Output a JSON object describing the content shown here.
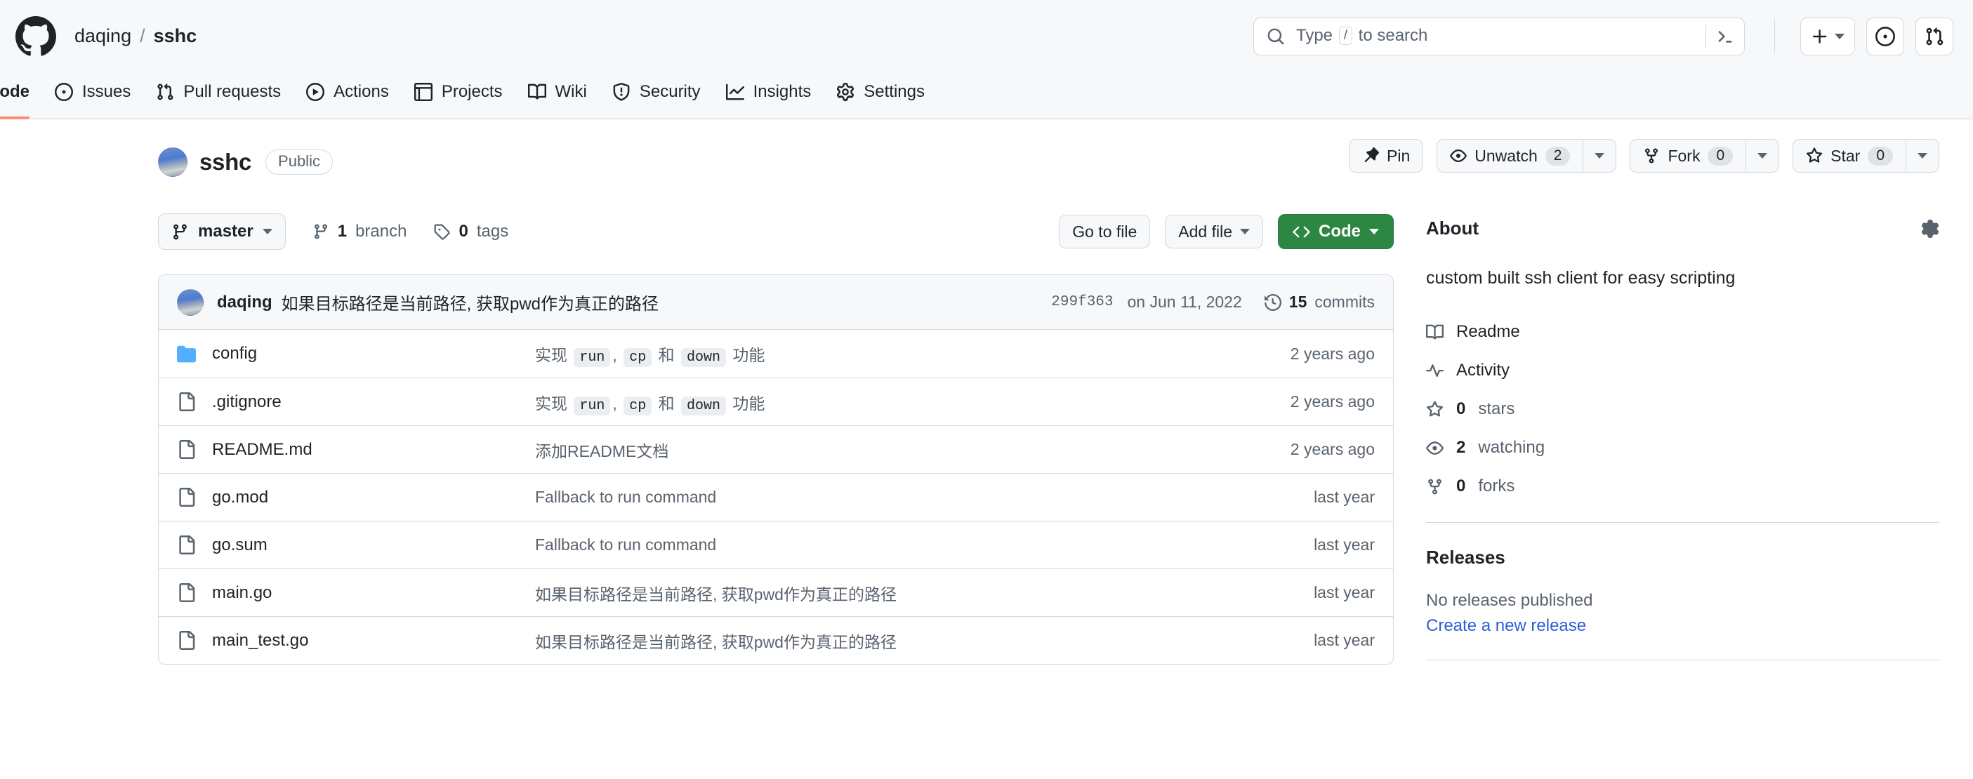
{
  "header": {
    "logo_icon": "github-logo-icon",
    "breadcrumb": {
      "owner": "daqing",
      "separator": "/",
      "repo": "sshc"
    },
    "search": {
      "placeholder_prefix": "Type",
      "key_hint": "/",
      "placeholder_suffix": "to search",
      "search_icon": "search-icon",
      "command_palette_icon": "terminal-icon"
    },
    "create_new_label": "+",
    "icons": {
      "plus_icon": "plus-icon",
      "issues_icon": "issue-opened-icon",
      "pull_requests_icon": "git-pull-request-icon"
    }
  },
  "repo_nav": {
    "items": [
      {
        "label": "Code",
        "icon": "code-icon",
        "active": true
      },
      {
        "label": "Issues",
        "icon": "issue-opened-icon",
        "active": false
      },
      {
        "label": "Pull requests",
        "icon": "git-pull-request-icon",
        "active": false
      },
      {
        "label": "Actions",
        "icon": "play-icon",
        "active": false
      },
      {
        "label": "Projects",
        "icon": "table-icon",
        "active": false
      },
      {
        "label": "Wiki",
        "icon": "book-icon",
        "active": false
      },
      {
        "label": "Security",
        "icon": "shield-icon",
        "active": false
      },
      {
        "label": "Insights",
        "icon": "graph-icon",
        "active": false
      },
      {
        "label": "Settings",
        "icon": "gear-icon",
        "active": false
      }
    ]
  },
  "repo_header": {
    "name": "sshc",
    "visibility": "Public",
    "actions": {
      "pin": "Pin",
      "unwatch": "Unwatch",
      "unwatch_count": "2",
      "fork": "Fork",
      "fork_count": "0",
      "star": "Star",
      "star_count": "0"
    }
  },
  "file_controls": {
    "branch": "master",
    "branch_count": "1",
    "branch_label": "branch",
    "tag_count": "0",
    "tag_label": "tags",
    "go_to_file": "Go to file",
    "add_file": "Add file",
    "code": "Code"
  },
  "commit_bar": {
    "author": "daqing",
    "message": "如果目标路径是当前路径, 获取pwd作为真正的路径",
    "sha": "299f363",
    "date": "on Jun 11, 2022",
    "commits_count": "15",
    "commits_label": "commits"
  },
  "files": [
    {
      "name": "config",
      "type": "folder",
      "message_parts": [
        {
          "text": "实现 ",
          "code": false
        },
        {
          "text": "run",
          "code": true
        },
        {
          "text": ", ",
          "code": false
        },
        {
          "text": "cp",
          "code": true
        },
        {
          "text": " 和 ",
          "code": false
        },
        {
          "text": "down",
          "code": true
        },
        {
          "text": " 功能",
          "code": false
        }
      ],
      "time": "2 years ago"
    },
    {
      "name": ".gitignore",
      "type": "file",
      "message_parts": [
        {
          "text": "实现 ",
          "code": false
        },
        {
          "text": "run",
          "code": true
        },
        {
          "text": ", ",
          "code": false
        },
        {
          "text": "cp",
          "code": true
        },
        {
          "text": " 和 ",
          "code": false
        },
        {
          "text": "down",
          "code": true
        },
        {
          "text": " 功能",
          "code": false
        }
      ],
      "time": "2 years ago"
    },
    {
      "name": "README.md",
      "type": "file",
      "message_parts": [
        {
          "text": "添加README文档",
          "code": false
        }
      ],
      "time": "2 years ago"
    },
    {
      "name": "go.mod",
      "type": "file",
      "message_parts": [
        {
          "text": "Fallback to run command",
          "code": false
        }
      ],
      "time": "last year"
    },
    {
      "name": "go.sum",
      "type": "file",
      "message_parts": [
        {
          "text": "Fallback to run command",
          "code": false
        }
      ],
      "time": "last year"
    },
    {
      "name": "main.go",
      "type": "file",
      "message_parts": [
        {
          "text": "如果目标路径是当前路径, 获取pwd作为真正的路径",
          "code": false
        }
      ],
      "time": "last year"
    },
    {
      "name": "main_test.go",
      "type": "file",
      "message_parts": [
        {
          "text": "如果目标路径是当前路径, 获取pwd作为真正的路径",
          "code": false
        }
      ],
      "time": "last year"
    }
  ],
  "sidebar": {
    "about_title": "About",
    "description": "custom built ssh client for easy scripting",
    "links": [
      {
        "label": "Readme",
        "icon": "book-icon",
        "count": null
      },
      {
        "label": "Activity",
        "icon": "pulse-icon",
        "count": null
      },
      {
        "label": "stars",
        "icon": "star-icon",
        "count": "0"
      },
      {
        "label": "watching",
        "icon": "eye-icon",
        "count": "2"
      },
      {
        "label": "forks",
        "icon": "repo-forked-icon",
        "count": "0"
      }
    ],
    "releases_title": "Releases",
    "releases_empty": "No releases published",
    "releases_cta": "Create a new release"
  },
  "colors": {
    "accent_green": "#2c8742",
    "active_tab_underline": "#fd8c73",
    "link_blue": "#2c5fd4",
    "folder_blue": "#54aeff",
    "header_bg": "#f6f8fa",
    "border": "#d1d9e0"
  }
}
